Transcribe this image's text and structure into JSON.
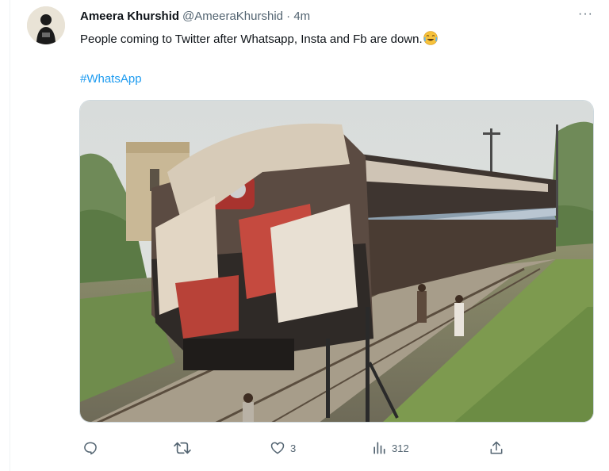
{
  "tweet": {
    "author_name": "Ameera Khurshid",
    "author_meta": "@AmeeraKhurshid · 4m",
    "text": "People coming to Twitter after Whatsapp, Insta and Fb are down.",
    "emoji": "face-with-tears-of-joy",
    "hashtag": "#WhatsApp",
    "media_description_icon": "photo"
  },
  "actions": {
    "reply": {
      "icon": "reply-icon",
      "count": ""
    },
    "retweet": {
      "icon": "retweet-icon",
      "count": ""
    },
    "like": {
      "icon": "like-icon",
      "count": "3"
    },
    "views": {
      "icon": "views-icon",
      "count": "312"
    },
    "share": {
      "icon": "share-icon",
      "count": ""
    }
  },
  "colors": {
    "link": "#1d9bf0",
    "secondary_text": "#536471",
    "primary_text": "#0f1419"
  }
}
